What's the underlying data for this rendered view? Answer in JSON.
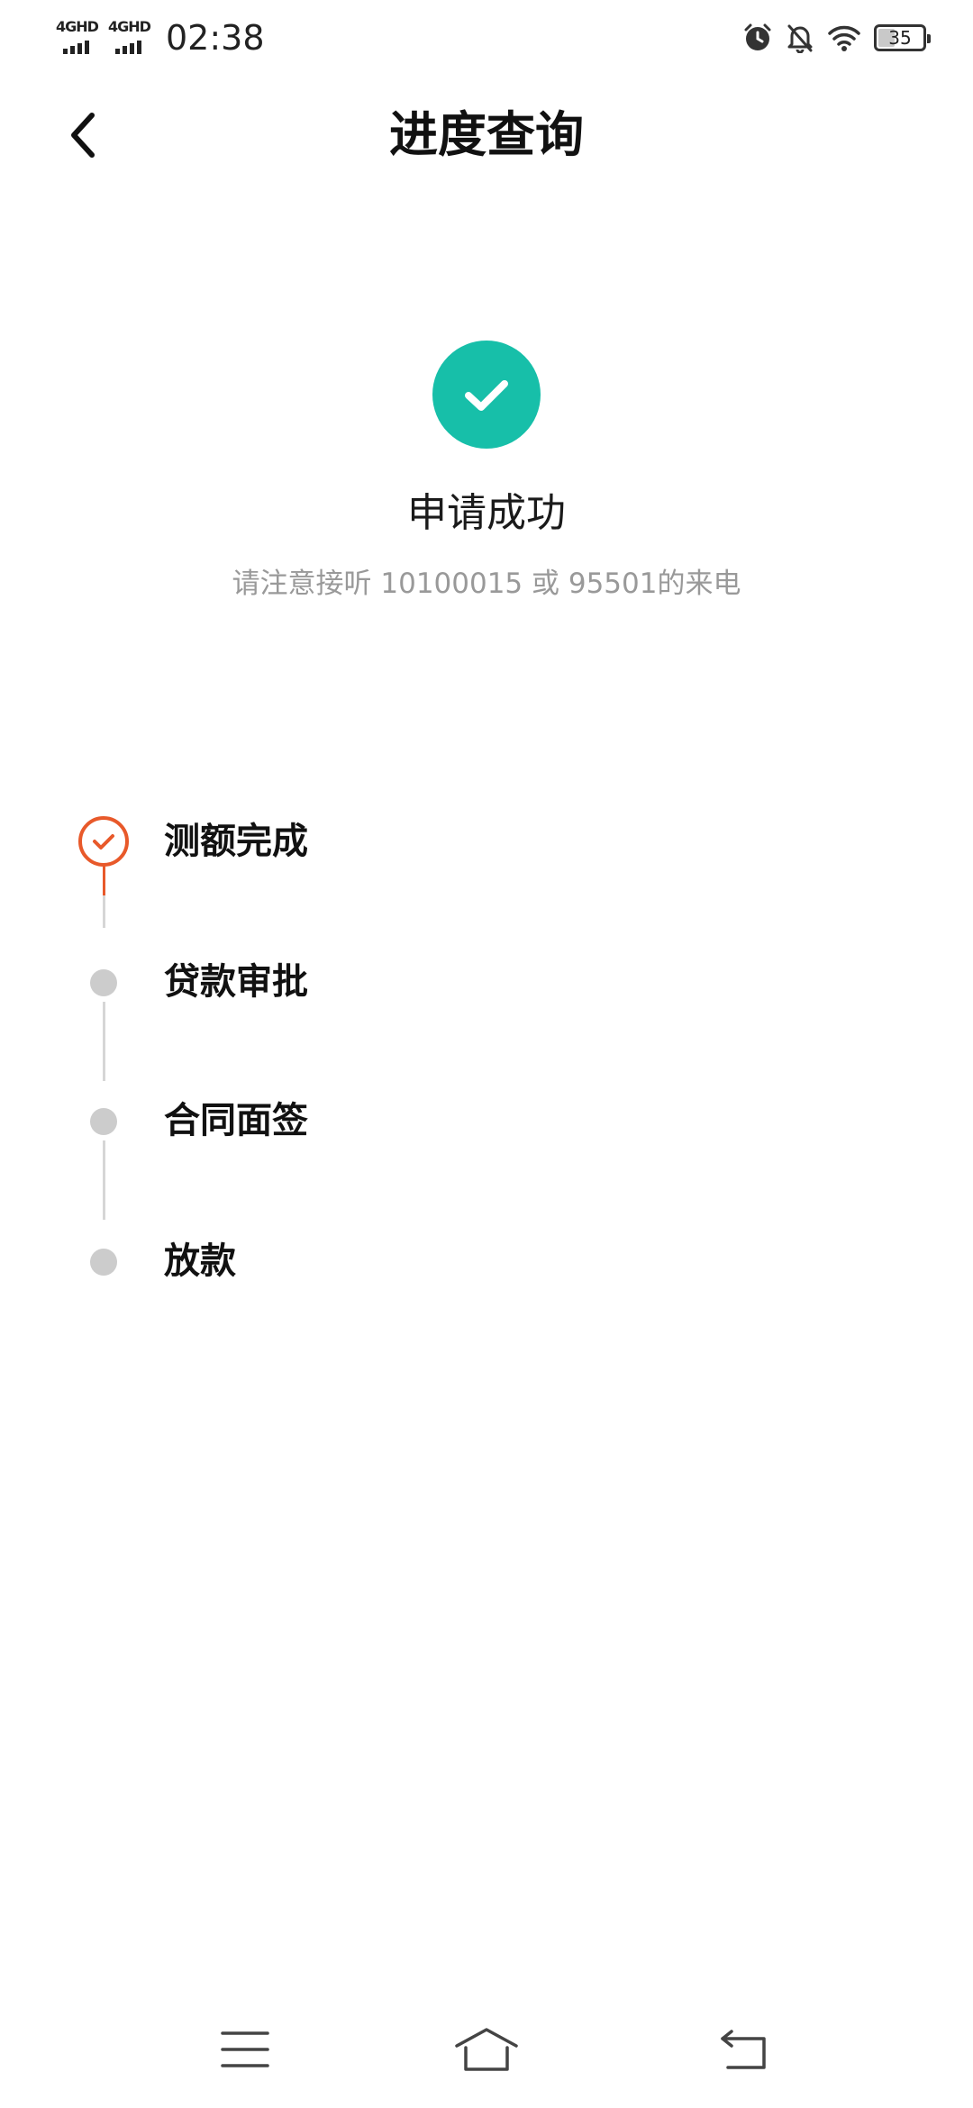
{
  "status_bar": {
    "sim1_network": "4GHD",
    "sim2_network": "4GHD",
    "time": "02:38",
    "battery_level": "35",
    "icons": [
      "alarm-icon",
      "bell-off-icon",
      "wifi-icon",
      "battery-icon"
    ]
  },
  "header": {
    "title": "进度查询",
    "back_icon": "chevron-left-icon"
  },
  "result": {
    "icon": "check-circle-icon",
    "icon_color": "#17bfa9",
    "title": "申请成功",
    "subtitle": "请注意接听 10100015 或 95501的来电"
  },
  "timeline": {
    "active_color": "#e8592a",
    "pending_color": "#cccccc",
    "steps": [
      {
        "label": "测额完成",
        "status": "done"
      },
      {
        "label": "贷款审批",
        "status": "pending"
      },
      {
        "label": "合同面签",
        "status": "pending"
      },
      {
        "label": "放款",
        "status": "pending"
      }
    ]
  },
  "system_nav": {
    "items": [
      "menu-icon",
      "home-icon",
      "back-icon"
    ]
  }
}
